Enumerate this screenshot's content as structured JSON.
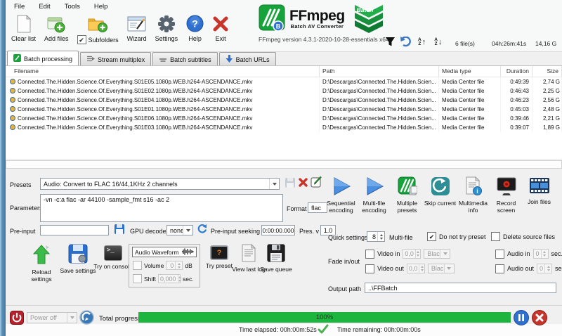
{
  "menu": {
    "file": "File",
    "edit": "Edit",
    "tools": "Tools",
    "help": "Help"
  },
  "toolbar": {
    "clear_list": "Clear list",
    "add_files": "Add files",
    "subfolders": "Subfolders",
    "wizard": "Wizard",
    "settings": "Settings",
    "help": "Help",
    "exit": "Exit"
  },
  "branding": {
    "app_name": "FFmpeg",
    "app_subtitle": "Batch AV Converter",
    "badge": "Batch",
    "version_line": "FFmpeg version 4.3.1-2020-10-28-essentials x64"
  },
  "summary": {
    "file_count": "6 file(s)",
    "total_duration": "04h:26m:41s",
    "total_size": "14,16 G"
  },
  "tabs": {
    "batch_processing": "Batch processing",
    "stream_multiplex": "Stream multiplex",
    "batch_subtitles": "Batch subtitles",
    "batch_urls": "Batch URLs"
  },
  "file_table": {
    "headers": {
      "filename": "Filename",
      "path": "Path",
      "media_type": "Media type",
      "duration": "Duration",
      "size": "Size"
    },
    "rows": [
      {
        "filename": "Connected.The.Hidden.Science.Of.Everything.S01E05.1080p.WEB.h264-ASCENDANCE.mkv",
        "path": "D:\\Descargas\\Connected.The.Hidden.Scien...",
        "media_type": "Media Center file",
        "duration": "0:49:39",
        "size": "2,74 G"
      },
      {
        "filename": "Connected.The.Hidden.Science.Of.Everything.S01E02.1080p.WEB.h264-ASCENDANCE.mkv",
        "path": "D:\\Descargas\\Connected.The.Hidden.Scien...",
        "media_type": "Media Center file",
        "duration": "0:46:43",
        "size": "2,25 G"
      },
      {
        "filename": "Connected.The.Hidden.Science.Of.Everything.S01E04.1080p.WEB.h264-ASCENDANCE.mkv",
        "path": "D:\\Descargas\\Connected.The.Hidden.Scien...",
        "media_type": "Media Center file",
        "duration": "0:46:23",
        "size": "2,56 G"
      },
      {
        "filename": "Connected.The.Hidden.Science.Of.Everything.S01E01.1080p.WEB.h264-ASCENDANCE.mkv",
        "path": "D:\\Descargas\\Connected.The.Hidden.Scien...",
        "media_type": "Media Center file",
        "duration": "0:45:03",
        "size": "2,48 G"
      },
      {
        "filename": "Connected.The.Hidden.Science.Of.Everything.S01E06.1080p.WEB.h264-ASCENDANCE.mkv",
        "path": "D:\\Descargas\\Connected.The.Hidden.Scien...",
        "media_type": "Media Center file",
        "duration": "0:39:46",
        "size": "2,21 G"
      },
      {
        "filename": "Connected.The.Hidden.Science.Of.Everything.S01E03.1080p.WEB.h264-ASCENDANCE.mkv",
        "path": "D:\\Descargas\\Connected.The.Hidden.Scien...",
        "media_type": "Media Center file",
        "duration": "0:39:07",
        "size": "1,89 G"
      }
    ]
  },
  "preset_panel": {
    "presets_label": "Presets",
    "preset_selected": "Audio: Convert to FLAC 16/44,1KHz 2 channels",
    "parameters_label": "Parameters",
    "parameters_value": "-vn -c:a flac -ar 44100 -sample_fmt s16 -ac 2",
    "format_label": "Format",
    "format_value": "flac",
    "pre_input_label": "Pre-input",
    "pre_input_value": "",
    "gpu_decode_label": "GPU decode",
    "gpu_decode_value": "none",
    "pre_input_seeking_label": "Pre-input seeking",
    "pre_input_seeking_value": "0:00:00.000",
    "preset_version_label": "Pres. v",
    "preset_version_value": "1.0"
  },
  "actions": {
    "sequential_encoding": "Sequential encoding",
    "multi_file_encoding": "Multi-file encoding",
    "multiple_presets": "Multiple presets",
    "skip_current": "Skip current",
    "multimedia_info": "Multimedia info",
    "record_screen": "Record screen",
    "join_files": "Join files"
  },
  "left_tools": {
    "reload_settings": "Reload settings",
    "save_settings": "Save settings",
    "try_on_console": "Try on console",
    "audio_waveform": "Audio Waveform",
    "volume_label": "Volume",
    "volume_value": "0",
    "volume_unit": "dB",
    "shift_label": "Shift",
    "shift_value": "0,000",
    "shift_unit": "sec.",
    "try_preset": "Try preset",
    "view_last_log": "View last log",
    "save_queue": "Save queue"
  },
  "quick_settings": {
    "label": "Quick settings",
    "multi_file_value": "8",
    "multi_file_label": "Multi-file",
    "do_not_try_preset": "Do not try preset",
    "delete_source_files": "Delete source files"
  },
  "fade": {
    "label": "Fade in/out",
    "video_in_label": "Video in",
    "video_in_value": "0,0",
    "video_in_color": "Black",
    "video_out_label": "Video out",
    "video_out_value": "0,0",
    "video_out_color": "Black",
    "audio_in_label": "Audio in",
    "audio_in_value": "0",
    "audio_in_unit": "sec.",
    "audio_out_label": "Audio out",
    "audio_out_value": "0",
    "audio_out_unit": "sec."
  },
  "output": {
    "label": "Output path",
    "value": "..\\FFBatch"
  },
  "status_bar": {
    "power_off": "Power off",
    "total_progress_label": "Total progress",
    "progress_percent": "100%",
    "time_elapsed": "Time elapsed: 00h:00m:52s",
    "time_remaining": "Time remaining: 00h:00m:00s"
  },
  "colors": {
    "brand_green": "#18a23c",
    "progress_green": "#1db53e",
    "accent_blue": "#2f6fd0",
    "alert_red": "#cc2a2a"
  }
}
